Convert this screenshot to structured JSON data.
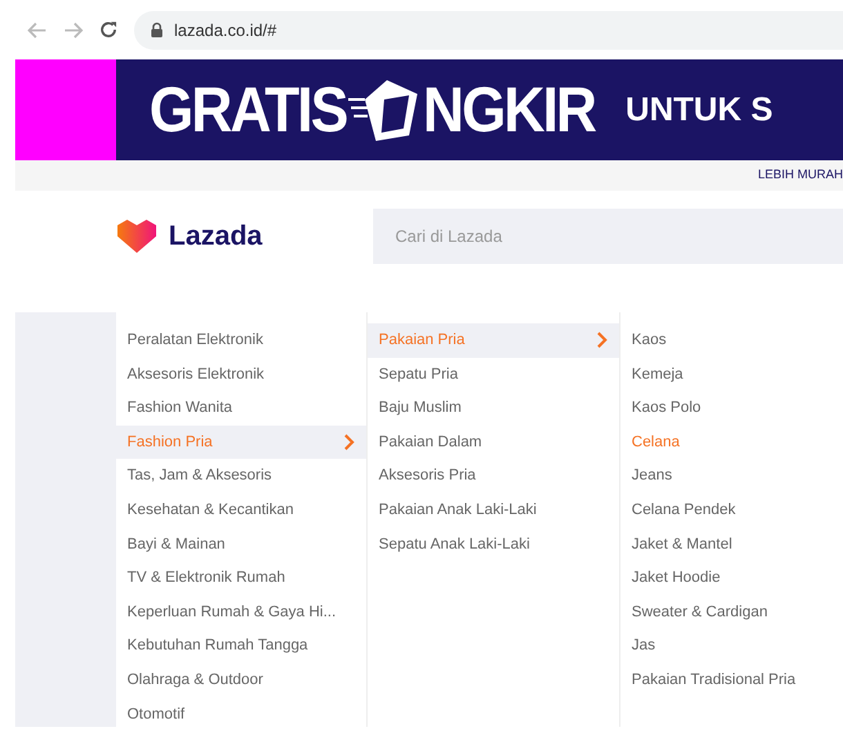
{
  "browser": {
    "url": "lazada.co.id/#"
  },
  "banner": {
    "word_before": "GRATIS",
    "word_after": "NGKIR",
    "tagline": "UNTUK S",
    "strip_text": "LEBIH MURAH"
  },
  "header": {
    "logo": "Lazada",
    "search": {
      "placeholder": "Cari di Lazada"
    }
  },
  "menu_columns": [
    {
      "kind": "parent",
      "items": [
        {
          "label": "Peralatan Elektronik",
          "selected": false
        },
        {
          "label": "Aksesoris Elektronik",
          "selected": false
        },
        {
          "label": "Fashion Wanita",
          "selected": false
        },
        {
          "label": "Fashion Pria",
          "selected": true
        },
        {
          "label": "Tas, Jam & Aksesoris",
          "selected": false
        },
        {
          "label": "Kesehatan & Kecantikan",
          "selected": false
        },
        {
          "label": "Bayi & Mainan",
          "selected": false
        },
        {
          "label": "TV & Elektronik Rumah",
          "selected": false
        },
        {
          "label": "Keperluan Rumah & Gaya Hi...",
          "selected": false
        },
        {
          "label": "Kebutuhan Rumah Tangga",
          "selected": false
        },
        {
          "label": "Olahraga & Outdoor",
          "selected": false
        },
        {
          "label": "Otomotif",
          "selected": false
        }
      ]
    },
    {
      "kind": "parent",
      "items": [
        {
          "label": "Pakaian Pria",
          "selected": true
        },
        {
          "label": "Sepatu Pria",
          "selected": false
        },
        {
          "label": "Baju Muslim",
          "selected": false
        },
        {
          "label": "Pakaian Dalam",
          "selected": false
        },
        {
          "label": "Aksesoris Pria",
          "selected": false
        },
        {
          "label": "Pakaian Anak Laki-Laki",
          "selected": false
        },
        {
          "label": "Sepatu Anak Laki-Laki",
          "selected": false
        }
      ]
    },
    {
      "kind": "leaf",
      "items": [
        {
          "label": "Kaos",
          "selected": false
        },
        {
          "label": "Kemeja",
          "selected": false
        },
        {
          "label": "Kaos Polo",
          "selected": false
        },
        {
          "label": "Celana",
          "selected": true
        },
        {
          "label": "Jeans",
          "selected": false
        },
        {
          "label": "Celana Pendek",
          "selected": false
        },
        {
          "label": "Jaket & Mantel",
          "selected": false
        },
        {
          "label": "Jaket Hoodie",
          "selected": false
        },
        {
          "label": "Sweater & Cardigan",
          "selected": false
        },
        {
          "label": "Jas",
          "selected": false
        },
        {
          "label": "Pakaian Tradisional Pria",
          "selected": false
        }
      ]
    }
  ]
}
